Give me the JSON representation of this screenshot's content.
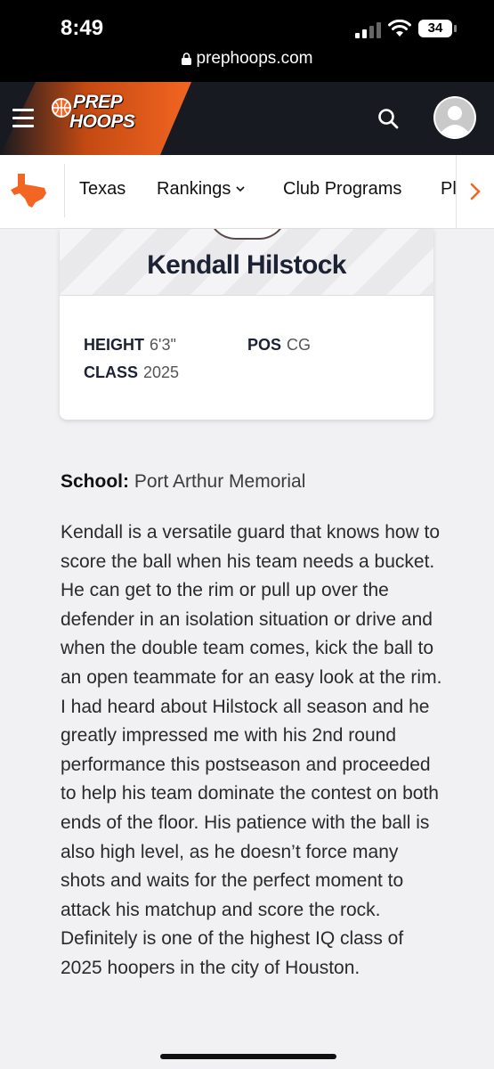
{
  "status": {
    "time": "8:49",
    "battery": "34",
    "url": "prephoops.com"
  },
  "brand": {
    "line1": "PREP",
    "line2": "HOOPS",
    "accent": "#f26522"
  },
  "nav": {
    "items": [
      "Texas",
      "Rankings",
      "Club Programs",
      "Pl"
    ]
  },
  "player": {
    "name": "Kendall Hilstock",
    "height_label": "HEIGHT",
    "height": "6'3\"",
    "pos_label": "POS",
    "pos": "CG",
    "class_label": "CLASS",
    "class": "2025"
  },
  "school": {
    "label": "School:",
    "value": "Port Arthur Memorial"
  },
  "bio": "Kendall is a versatile guard that knows how to score the ball when his team needs a bucket. He can get to the rim or pull up over the defender in an isolation situation or drive and when the double team comes, kick the ball to an open teammate for an easy look at the rim. I had heard about Hilstock all season and he greatly impressed me with his 2nd round performance this postseason and proceeded to help his team dominate the contest on both ends of the floor. His patience with the ball is also high level, as he doesn’t force many shots and waits for the perfect moment to attack his matchup and score the rock. Definitely is one of the highest IQ class of 2025 hoopers in the city of Houston."
}
